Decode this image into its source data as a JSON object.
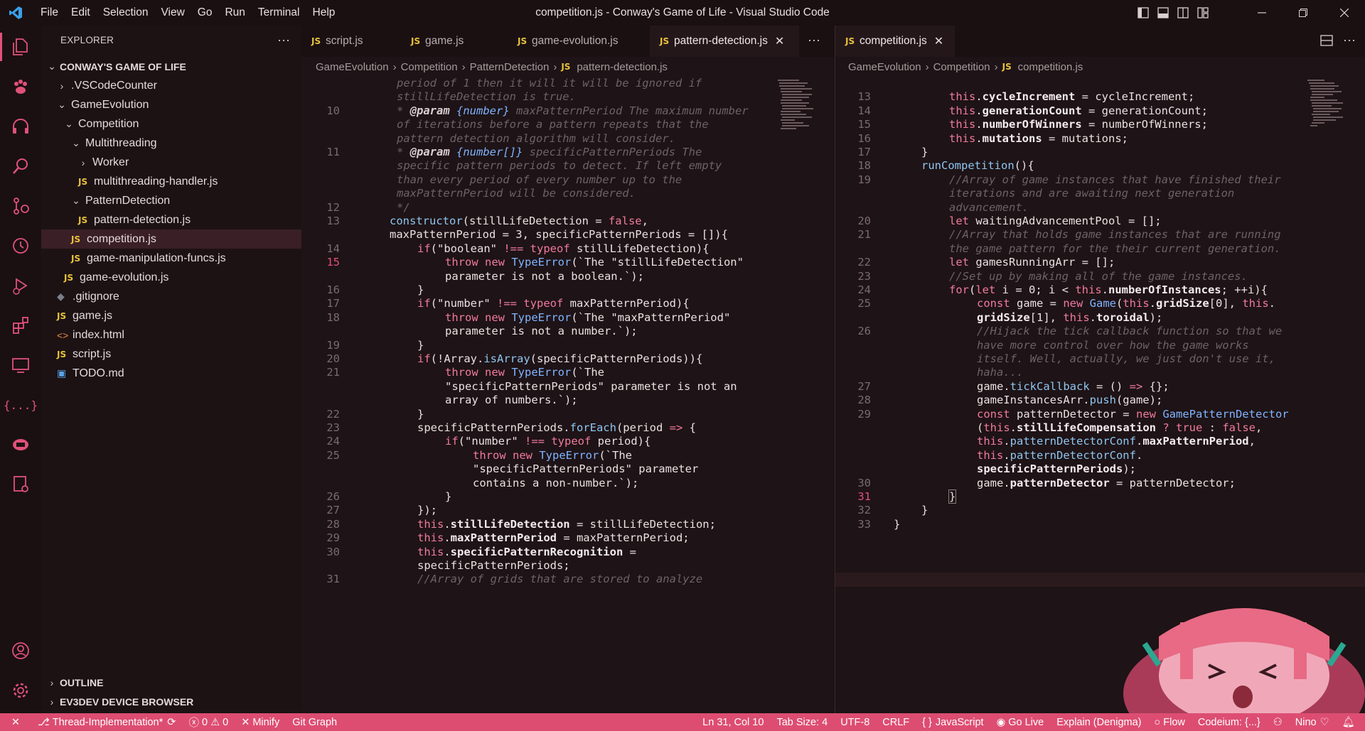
{
  "titlebar": {
    "title": "competition.js - Conway's Game of Life - Visual Studio Code",
    "menu": [
      "File",
      "Edit",
      "Selection",
      "View",
      "Go",
      "Run",
      "Terminal",
      "Help"
    ]
  },
  "sidebar": {
    "header": "EXPLORER",
    "root": "CONWAY'S GAME OF LIFE",
    "items": [
      {
        "label": ".VSCodeCounter"
      },
      {
        "label": "GameEvolution"
      },
      {
        "label": "Competition"
      },
      {
        "label": "Multithreading"
      },
      {
        "label": "Worker"
      },
      {
        "label": "multithreading-handler.js"
      },
      {
        "label": "PatternDetection"
      },
      {
        "label": "pattern-detection.js"
      },
      {
        "label": "competition.js"
      },
      {
        "label": "game-manipulation-funcs.js"
      },
      {
        "label": "game-evolution.js"
      },
      {
        "label": ".gitignore"
      },
      {
        "label": "game.js"
      },
      {
        "label": "index.html"
      },
      {
        "label": "script.js"
      },
      {
        "label": "TODO.md"
      }
    ],
    "outline": "OUTLINE",
    "ev3dev": "EV3DEV DEVICE BROWSER"
  },
  "left_editor": {
    "tabs": [
      {
        "label": "script.js"
      },
      {
        "label": "game.js"
      },
      {
        "label": "game-evolution.js"
      },
      {
        "label": "pattern-detection.js"
      }
    ],
    "breadcrumb": [
      "GameEvolution",
      "Competition",
      "PatternDetection",
      "pattern-detection.js"
    ]
  },
  "right_editor": {
    "tabs": [
      {
        "label": "competition.js"
      }
    ],
    "breadcrumb": [
      "GameEvolution",
      "Competition",
      "competition.js"
    ]
  },
  "statusbar": {
    "branch": "Thread-Implementation*",
    "errors": "0",
    "warnings": "0",
    "minify": "Minify",
    "gitgraph": "Git Graph",
    "position": "Ln 31, Col 10",
    "tabsize": "Tab Size: 4",
    "encoding": "UTF-8",
    "eol": "CRLF",
    "language": "JavaScript",
    "golive": "Go Live",
    "explain": "Explain (Denigma)",
    "flow": "Flow",
    "codeium": "Codeium: {...}",
    "user": "Nino"
  }
}
